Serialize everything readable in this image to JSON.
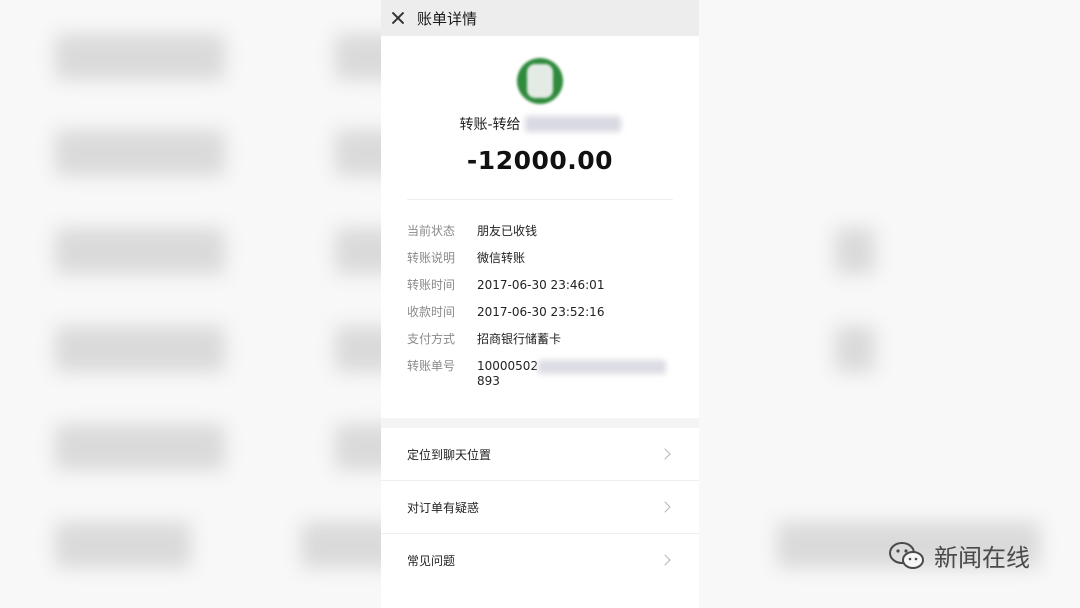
{
  "topbar": {
    "title": "账单详情"
  },
  "header": {
    "title_prefix": "转账-转给",
    "amount": "-12000.00"
  },
  "details": {
    "rows": [
      {
        "label": "当前状态",
        "value": "朋友已收钱"
      },
      {
        "label": "转账说明",
        "value": "微信转账"
      },
      {
        "label": "转账时间",
        "value": "2017-06-30 23:46:01"
      },
      {
        "label": "收款时间",
        "value": "2017-06-30 23:52:16"
      },
      {
        "label": "支付方式",
        "value": "招商银行储蓄卡"
      }
    ],
    "order": {
      "label": "转账单号",
      "prefix": "10000502",
      "suffix": "893"
    }
  },
  "menu": [
    {
      "label": "定位到聊天位置"
    },
    {
      "label": "对订单有疑惑"
    },
    {
      "label": "常见问题"
    }
  ],
  "watermark": {
    "text": "新闻在线"
  },
  "colors": {
    "topbar": "#ededed",
    "avatar": "#2f8a3d"
  },
  "icons": [
    "close-icon",
    "chevron-right-icon",
    "wechat-logo-icon"
  ]
}
